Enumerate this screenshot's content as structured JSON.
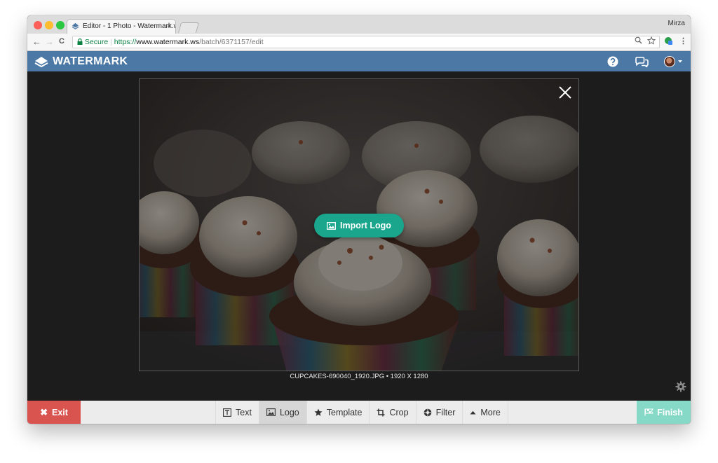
{
  "browser": {
    "tab_title": "Editor - 1 Photo - Watermark.w",
    "tab_close": "×",
    "profile_name": "Mirza",
    "secure_label": "Secure",
    "url_scheme": "https://",
    "url_host": "www.watermark.ws",
    "url_path": "/batch/6371157/edit",
    "nav_back": "←",
    "nav_forward": "→",
    "nav_reload": "C"
  },
  "app": {
    "brand": "WATERMARK",
    "colors": {
      "header": "#4b78a5",
      "accent": "#1aa68d",
      "exit": "#d9534f",
      "finish": "#86d9c6"
    }
  },
  "editor": {
    "import_label": "Import Logo",
    "caption": "CUPCAKES-690040_1920.JPG • 1920 X 1280"
  },
  "toolbar": {
    "exit_label": "Exit",
    "finish_label": "Finish",
    "tools": [
      {
        "label": "Text",
        "icon": "text-box-icon",
        "active": false
      },
      {
        "label": "Logo",
        "icon": "image-icon",
        "active": true
      },
      {
        "label": "Template",
        "icon": "star-icon",
        "active": false
      },
      {
        "label": "Crop",
        "icon": "crop-icon",
        "active": false
      },
      {
        "label": "Filter",
        "icon": "filter-aperture-icon",
        "active": false
      },
      {
        "label": "More",
        "icon": "caret-up-icon",
        "active": false
      }
    ]
  }
}
